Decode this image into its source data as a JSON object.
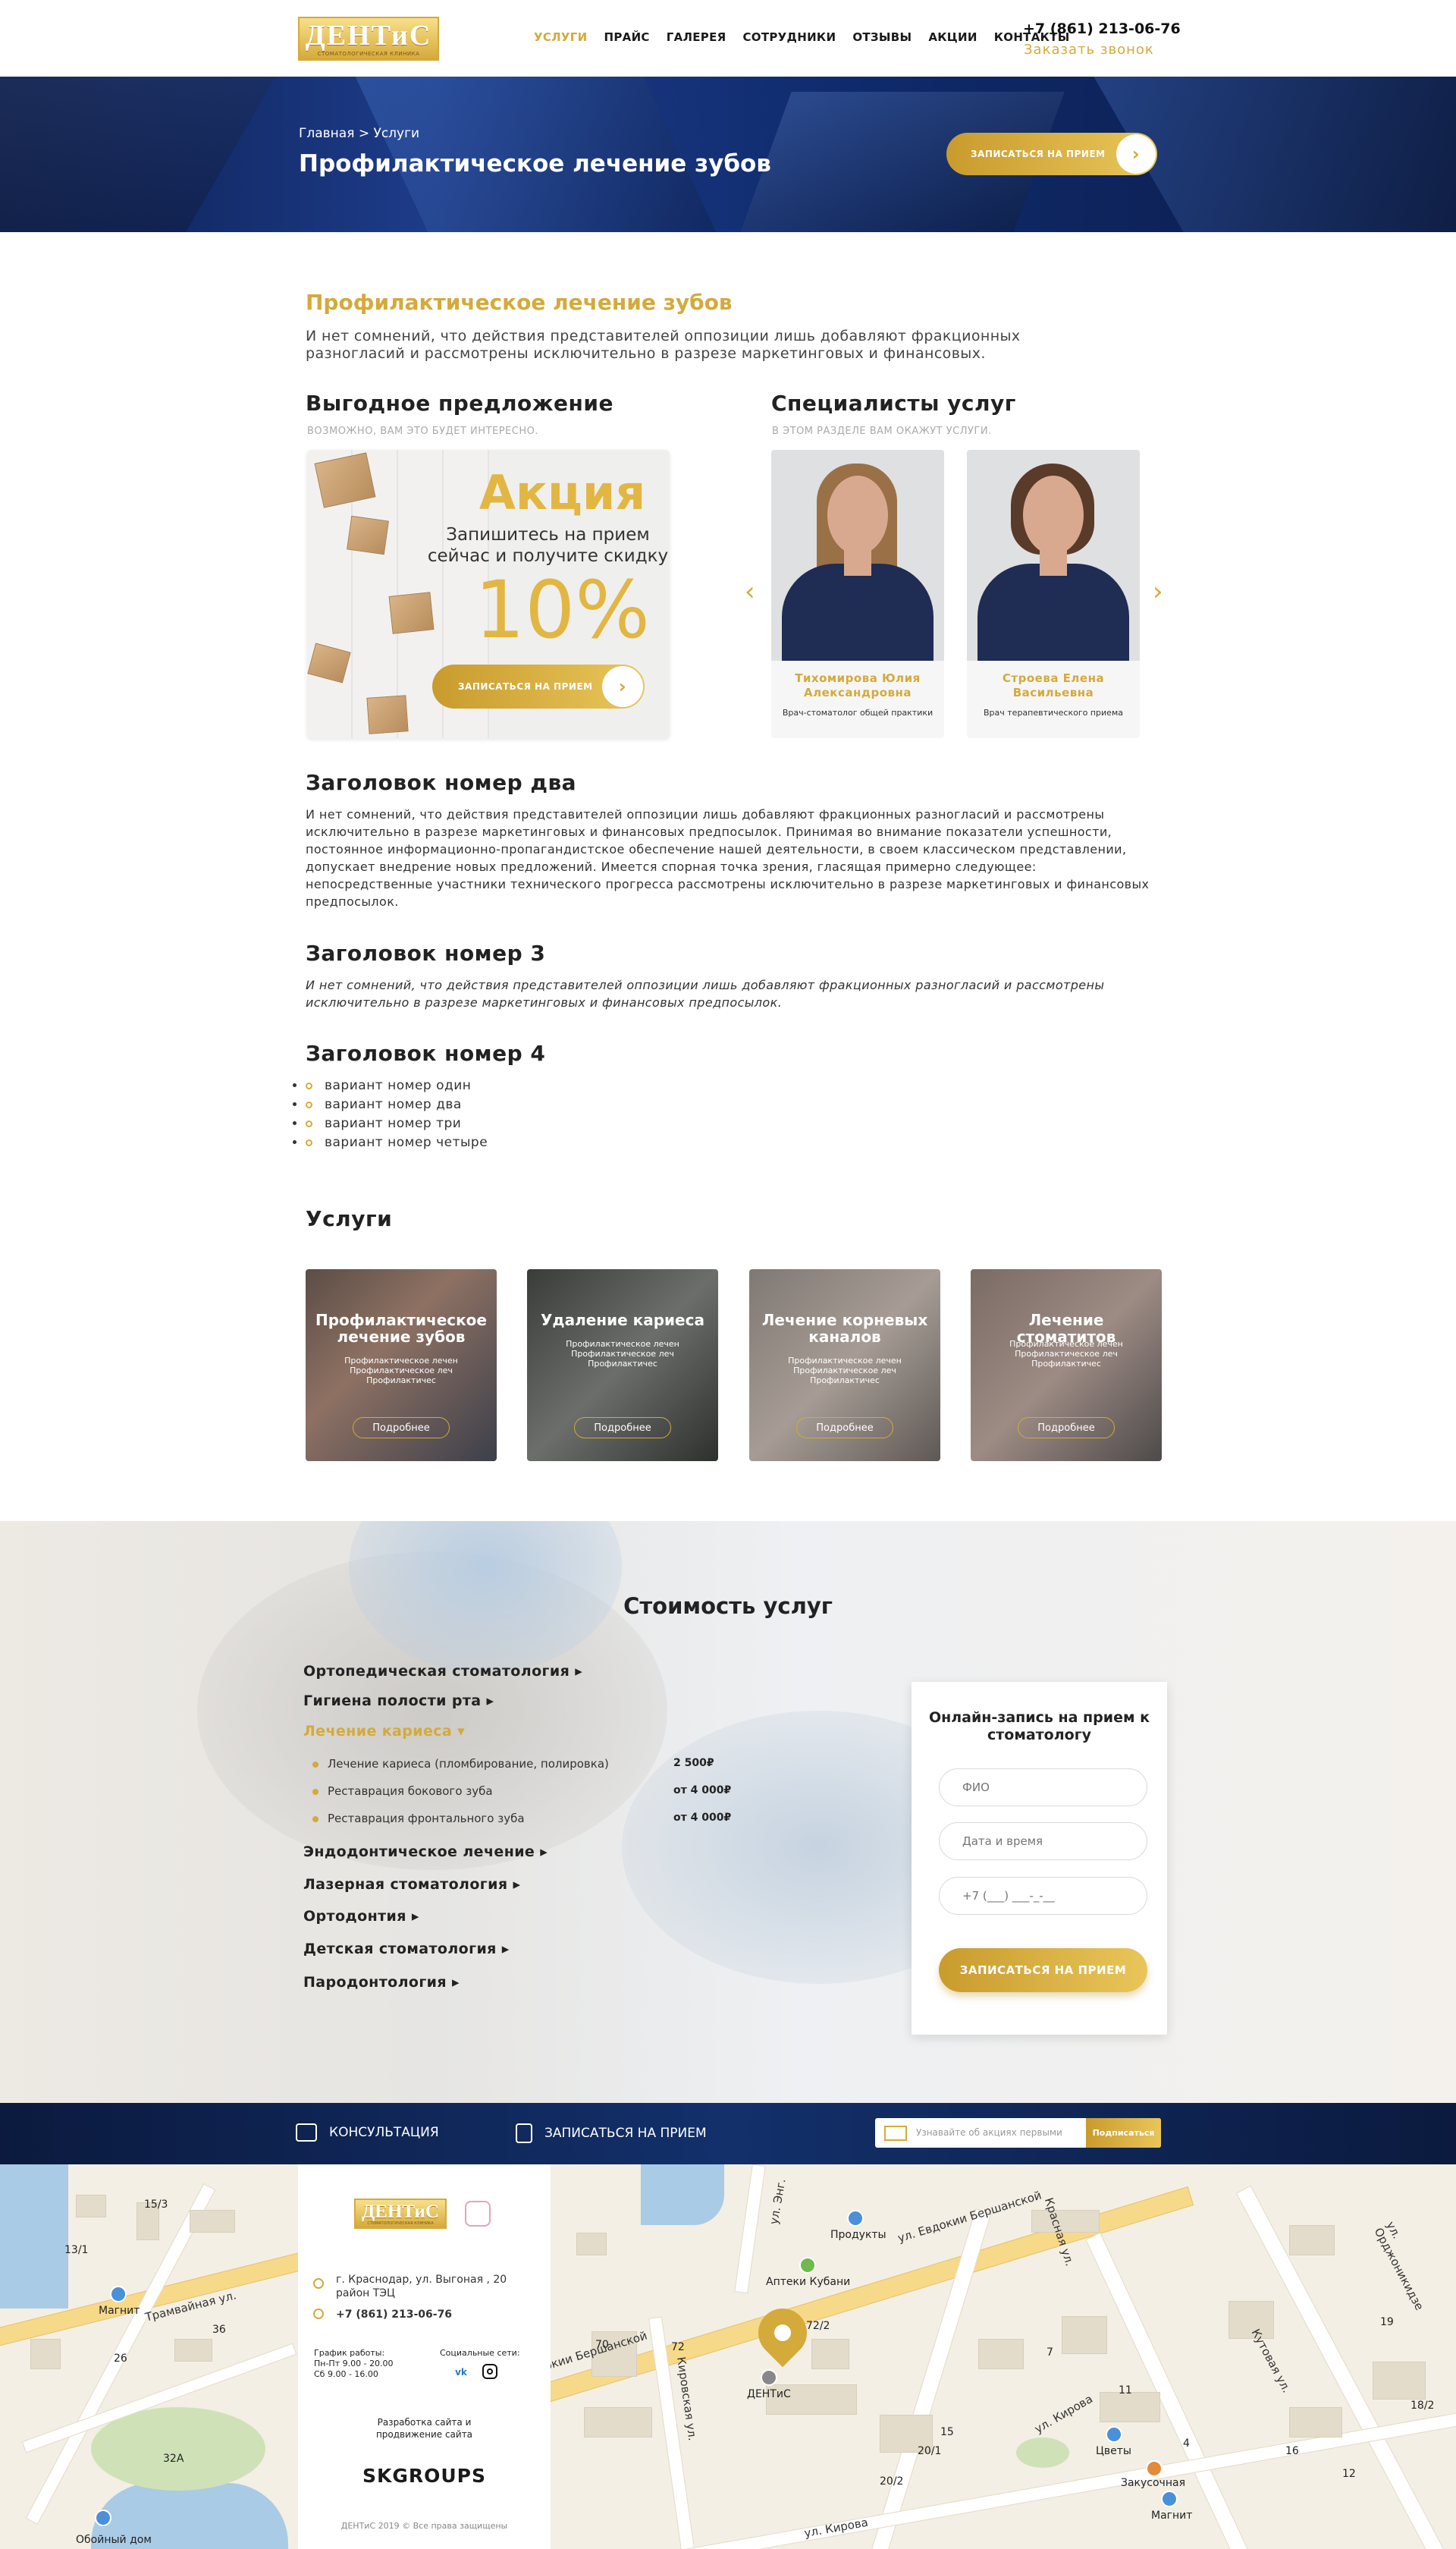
{
  "header": {
    "logo": "ДЕНТиС",
    "logo_sub": "СТОМАТОЛОГИЧЕСКАЯ КЛИНИКА",
    "nav": [
      "УСЛУГИ",
      "ПРАЙС",
      "ГАЛЕРЕЯ",
      "СОТРУДНИКИ",
      "ОТЗЫВЫ",
      "АКЦИИ",
      "КОНТАКТЫ"
    ],
    "phone": "+7 (861) 213-06-76",
    "callback": "Заказать звонок"
  },
  "hero": {
    "breadcrumb": "Главная > Услуги",
    "title": "Профилактическое лечение зубов",
    "button": "ЗАПИСАТЬСЯ НА ПРИЕМ",
    "button_icon": "chevron-right-icon"
  },
  "intro": {
    "title": "Профилактическое лечение зубов",
    "text": "И нет сомнений, что действия представителей оппозиции лишь добавляют фракционных разногласий и рассмотрены исключительно в разрезе маркетинговых и финансовых."
  },
  "offer": {
    "title": "Выгодное предложение",
    "subtitle": "ВОЗМОЖНО, ВАМ ЭТО БУДЕТ ИНТЕРЕСНО.",
    "promo_title": "Акция",
    "promo_text": "Запишитесь на прием сейчас и получите скидку",
    "promo_value": "10%",
    "promo_button": "ЗАПИСАТЬСЯ НА ПРИЕМ"
  },
  "specialists": {
    "title": "Специалисты услуг",
    "subtitle": "В ЭТОМ РАЗДЕЛЕ ВАМ ОКАЖУТ УСЛУГИ.",
    "items": [
      {
        "name": "Тихомирова Юлия Александровна",
        "role": "Врач-стоматолог общей практики"
      },
      {
        "name": "Строева Елена Васильевна",
        "role": "Врач терапевтического приема"
      }
    ]
  },
  "section2": {
    "title": "Заголовок номер два",
    "text": "И нет сомнений, что действия представителей оппозиции лишь добавляют фракционных разногласий и рассмотрены исключительно в разрезе маркетинговых и финансовых предпосылок. Принимая во внимание показатели успешности, постоянное информационно-пропагандистское обеспечение нашей деятельности, в своем классическом представлении, допускает внедрение новых предложений. Имеется спорная точка зрения, гласящая примерно следующее: непосредственные участники технического прогресса рассмотрены исключительно в разрезе маркетинговых и финансовых предпосылок."
  },
  "section3": {
    "title": "Заголовок номер 3",
    "text": "И нет сомнений, что действия представителей оппозиции лишь добавляют фракционных разногласий и рассмотрены исключительно в разрезе маркетинговых и финансовых предпосылок."
  },
  "section4": {
    "title": "Заголовок номер 4",
    "items": [
      "вариант номер один",
      "вариант номер два",
      "вариант номер три",
      "вариант номер четыре"
    ]
  },
  "services": {
    "title": "Услуги",
    "items": [
      {
        "title": "Профилактическое лечение зубов",
        "desc": "Профилактическое лечен Профилактическое леч Профилактичес",
        "button": "Подробнее"
      },
      {
        "title": "Удаление кариеса",
        "desc": "Профилактическое лечен Профилактическое леч Профилактичес",
        "button": "Подробнее"
      },
      {
        "title": "Лечение корневых каналов",
        "desc": "Профилактическое лечен Профилактическое леч Профилактичес",
        "button": "Подробнее"
      },
      {
        "title": "Лечение стоматитов",
        "desc": "Профилактическое лечен Профилактическое леч Профилактичес",
        "button": "Подробнее"
      }
    ]
  },
  "pricing": {
    "title": "Стоимость услуг",
    "categories": [
      "Ортопедическая стоматология",
      "Гигиена полости рта",
      "Лечение кариеса",
      "Эндодонтическое лечение",
      "Лазерная стоматология",
      "Ортодонтия",
      "Детская стоматология",
      "Пародонтология"
    ],
    "open_items": [
      {
        "name": "Лечение кариеса (пломбирование, полировка)",
        "price": "2 500₽"
      },
      {
        "name": "Реставрация бокового зуба",
        "price": "от 4 000₽"
      },
      {
        "name": "Реставрация фронтального зуба",
        "price": "от 4 000₽"
      }
    ]
  },
  "form": {
    "title": "Онлайн-запись на прием к стоматологу",
    "name_placeholder": "ФИО",
    "date_placeholder": "Дата и время",
    "phone_placeholder": "+7 (___) ___-_-__",
    "button": "ЗАПИСАТЬСЯ НА ПРИЕМ"
  },
  "strip": {
    "consult": "КОНСУЛЬТАЦИЯ",
    "appointment": "ЗАПИСАТЬСЯ НА ПРИЕМ",
    "subscribe_placeholder": "Узнавайте об акциях первыми",
    "subscribe_button": "Подписаться"
  },
  "footer": {
    "logo": "ДЕНТиС",
    "logo_sub": "СТОМАТОЛОГИЧЕСКАЯ КЛИНИКА",
    "address": "г. Краснодар, ул. Выгоная , 20 район ТЭЦ",
    "phone": "+7 (861) 213-06-76",
    "schedule_title": "График работы:",
    "schedule_1": "Пн-Пт 9.00 - 20.00",
    "schedule_2": "Сб 9.00 - 16.00",
    "social_title": "Социальные сети:",
    "developer": "Разработка сайта и продвижение сайта",
    "developer_brand": "SKGROUPS",
    "copyright": "ДЕНТиС 2019 © Все права защищены"
  },
  "map": {
    "labels": [
      "Трамвайная ул.",
      "ул. Евдокии Бершанской",
      "Красная ул.",
      "Кировская ул.",
      "ул. Кирова",
      "Кутовая ул.",
      "ул. Орджоникидзе",
      "ул. Энг.",
      "ул. Кирова"
    ],
    "places": [
      "Магнит",
      "Продукты",
      "Аптеки Кубани",
      "ДЕНТиС",
      "Цветы",
      "Закусочная",
      "Магнит",
      "Обойный дом"
    ],
    "numbers": [
      "15/3",
      "13/1",
      "36",
      "26",
      "70",
      "72",
      "72/2",
      "20/1",
      "20/2",
      "16",
      "12",
      "32А",
      "18/2",
      "19",
      "7",
      "4",
      "15",
      "11"
    ]
  },
  "colors": {
    "accent": "#d4aa3a",
    "hero_dark": "#0c1e4f",
    "strip_dark": "#0b1a3e"
  }
}
